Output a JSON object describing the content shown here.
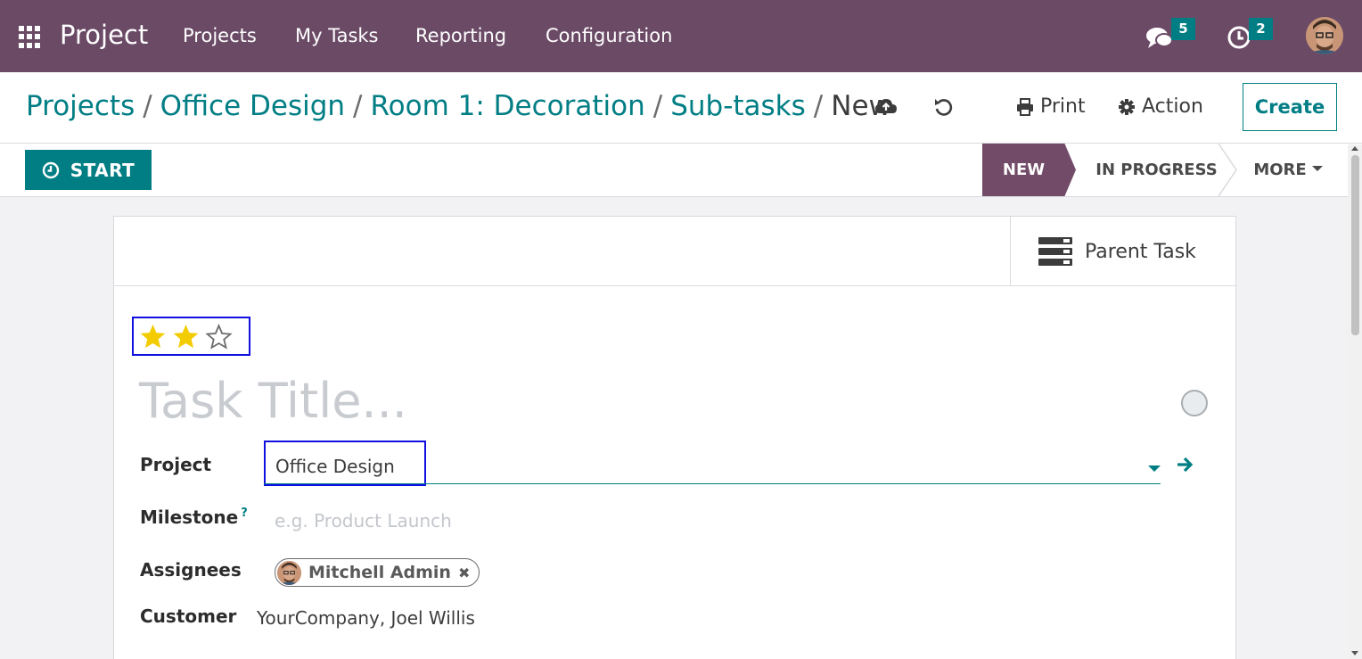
{
  "navbar": {
    "app_name": "Project",
    "menu": [
      "Projects",
      "My Tasks",
      "Reporting",
      "Configuration"
    ],
    "messages_count": "5",
    "activities_count": "2",
    "accent": "#6b4a66"
  },
  "breadcrumb": {
    "items": [
      "Projects",
      "Office Design",
      "Room 1: Decoration",
      "Sub-tasks"
    ],
    "current": "New",
    "separator": "/"
  },
  "actions": {
    "print": "Print",
    "action": "Action",
    "create": "Create"
  },
  "statusbar": {
    "start_label": "START",
    "stages": [
      "NEW",
      "IN PROGRESS"
    ],
    "more_label": "MORE",
    "active_stage": "NEW"
  },
  "form": {
    "smart_button": "Parent Task",
    "priority": {
      "filled": 2,
      "total": 3
    },
    "title_placeholder": "Task Title...",
    "project_label": "Project",
    "project_value": "Office Design",
    "milestone_label": "Milestone",
    "milestone_help": "?",
    "milestone_placeholder": "e.g. Product Launch",
    "assignees_label": "Assignees",
    "assignee_name": "Mitchell Admin",
    "customer_label": "Customer",
    "customer_value": "YourCompany, Joel Willis"
  },
  "colors": {
    "primary": "#017e84",
    "stage_active": "#714b67",
    "star": "#f3cc00",
    "highlight_border": "#1010e0"
  }
}
